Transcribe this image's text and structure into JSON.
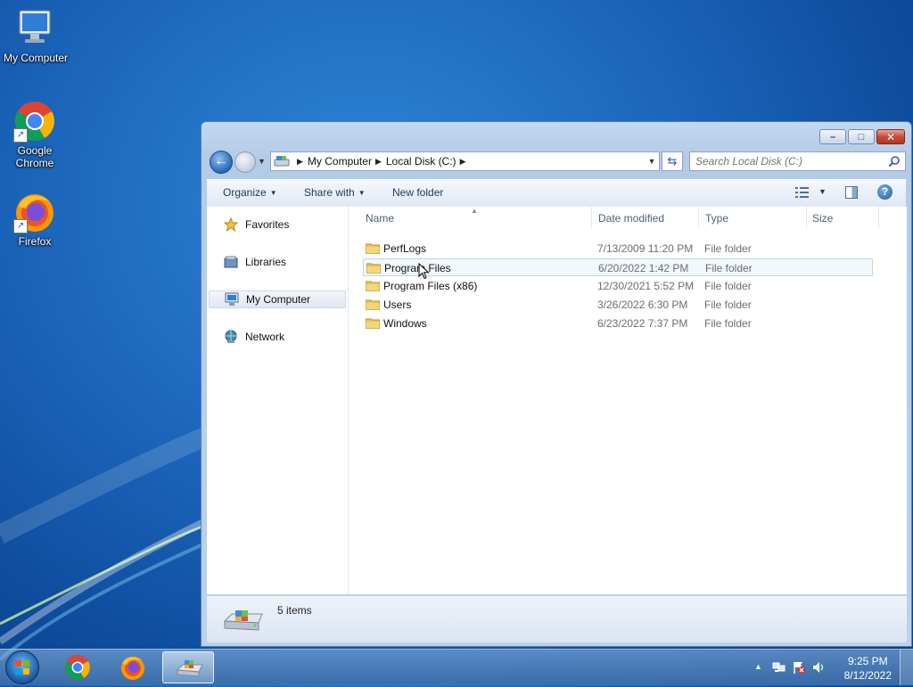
{
  "desktop": {
    "icons": [
      {
        "label": "My Computer",
        "icon": "computer-icon"
      },
      {
        "label": "Google\nChrome",
        "icon": "chrome-icon"
      },
      {
        "label": "Firefox",
        "icon": "firefox-icon"
      }
    ]
  },
  "explorer": {
    "window_controls": {
      "minimize": "–",
      "maximize": "□",
      "close": "✕"
    },
    "address": {
      "crumbs": [
        "My Computer",
        "Local Disk (C:)"
      ]
    },
    "search": {
      "placeholder": "Search Local Disk (C:)"
    },
    "toolbar": {
      "organize": "Organize",
      "share_with": "Share with",
      "new_folder": "New folder"
    },
    "nav_pane": [
      {
        "label": "Favorites",
        "icon": "star-icon"
      },
      {
        "label": "Libraries",
        "icon": "libraries-icon"
      },
      {
        "label": "My Computer",
        "icon": "computer-icon",
        "selected": true
      },
      {
        "label": "Network",
        "icon": "network-icon"
      }
    ],
    "columns": [
      "Name",
      "Date modified",
      "Type",
      "Size"
    ],
    "files": [
      {
        "name": "PerfLogs",
        "date": "7/13/2009 11:20 PM",
        "type": "File folder"
      },
      {
        "name": "Program Files",
        "date": "6/20/2022 1:42 PM",
        "type": "File folder",
        "hovered": true
      },
      {
        "name": "Program Files (x86)",
        "date": "12/30/2021 5:52 PM",
        "type": "File folder"
      },
      {
        "name": "Users",
        "date": "3/26/2022 6:30 PM",
        "type": "File folder"
      },
      {
        "name": "Windows",
        "date": "6/23/2022 7:37 PM",
        "type": "File folder"
      }
    ],
    "status": {
      "count": "5 items"
    }
  },
  "taskbar": {
    "apps": [
      "chrome-icon",
      "firefox-icon",
      "explorer-icon"
    ],
    "clock": {
      "time": "9:25 PM",
      "date": "8/12/2022"
    }
  },
  "colors": {
    "desktop_blue": "#1a63b8",
    "window_frame": "#bcd2ea",
    "close_red": "#c74b36",
    "folder_yellow": "#e9c45a"
  }
}
